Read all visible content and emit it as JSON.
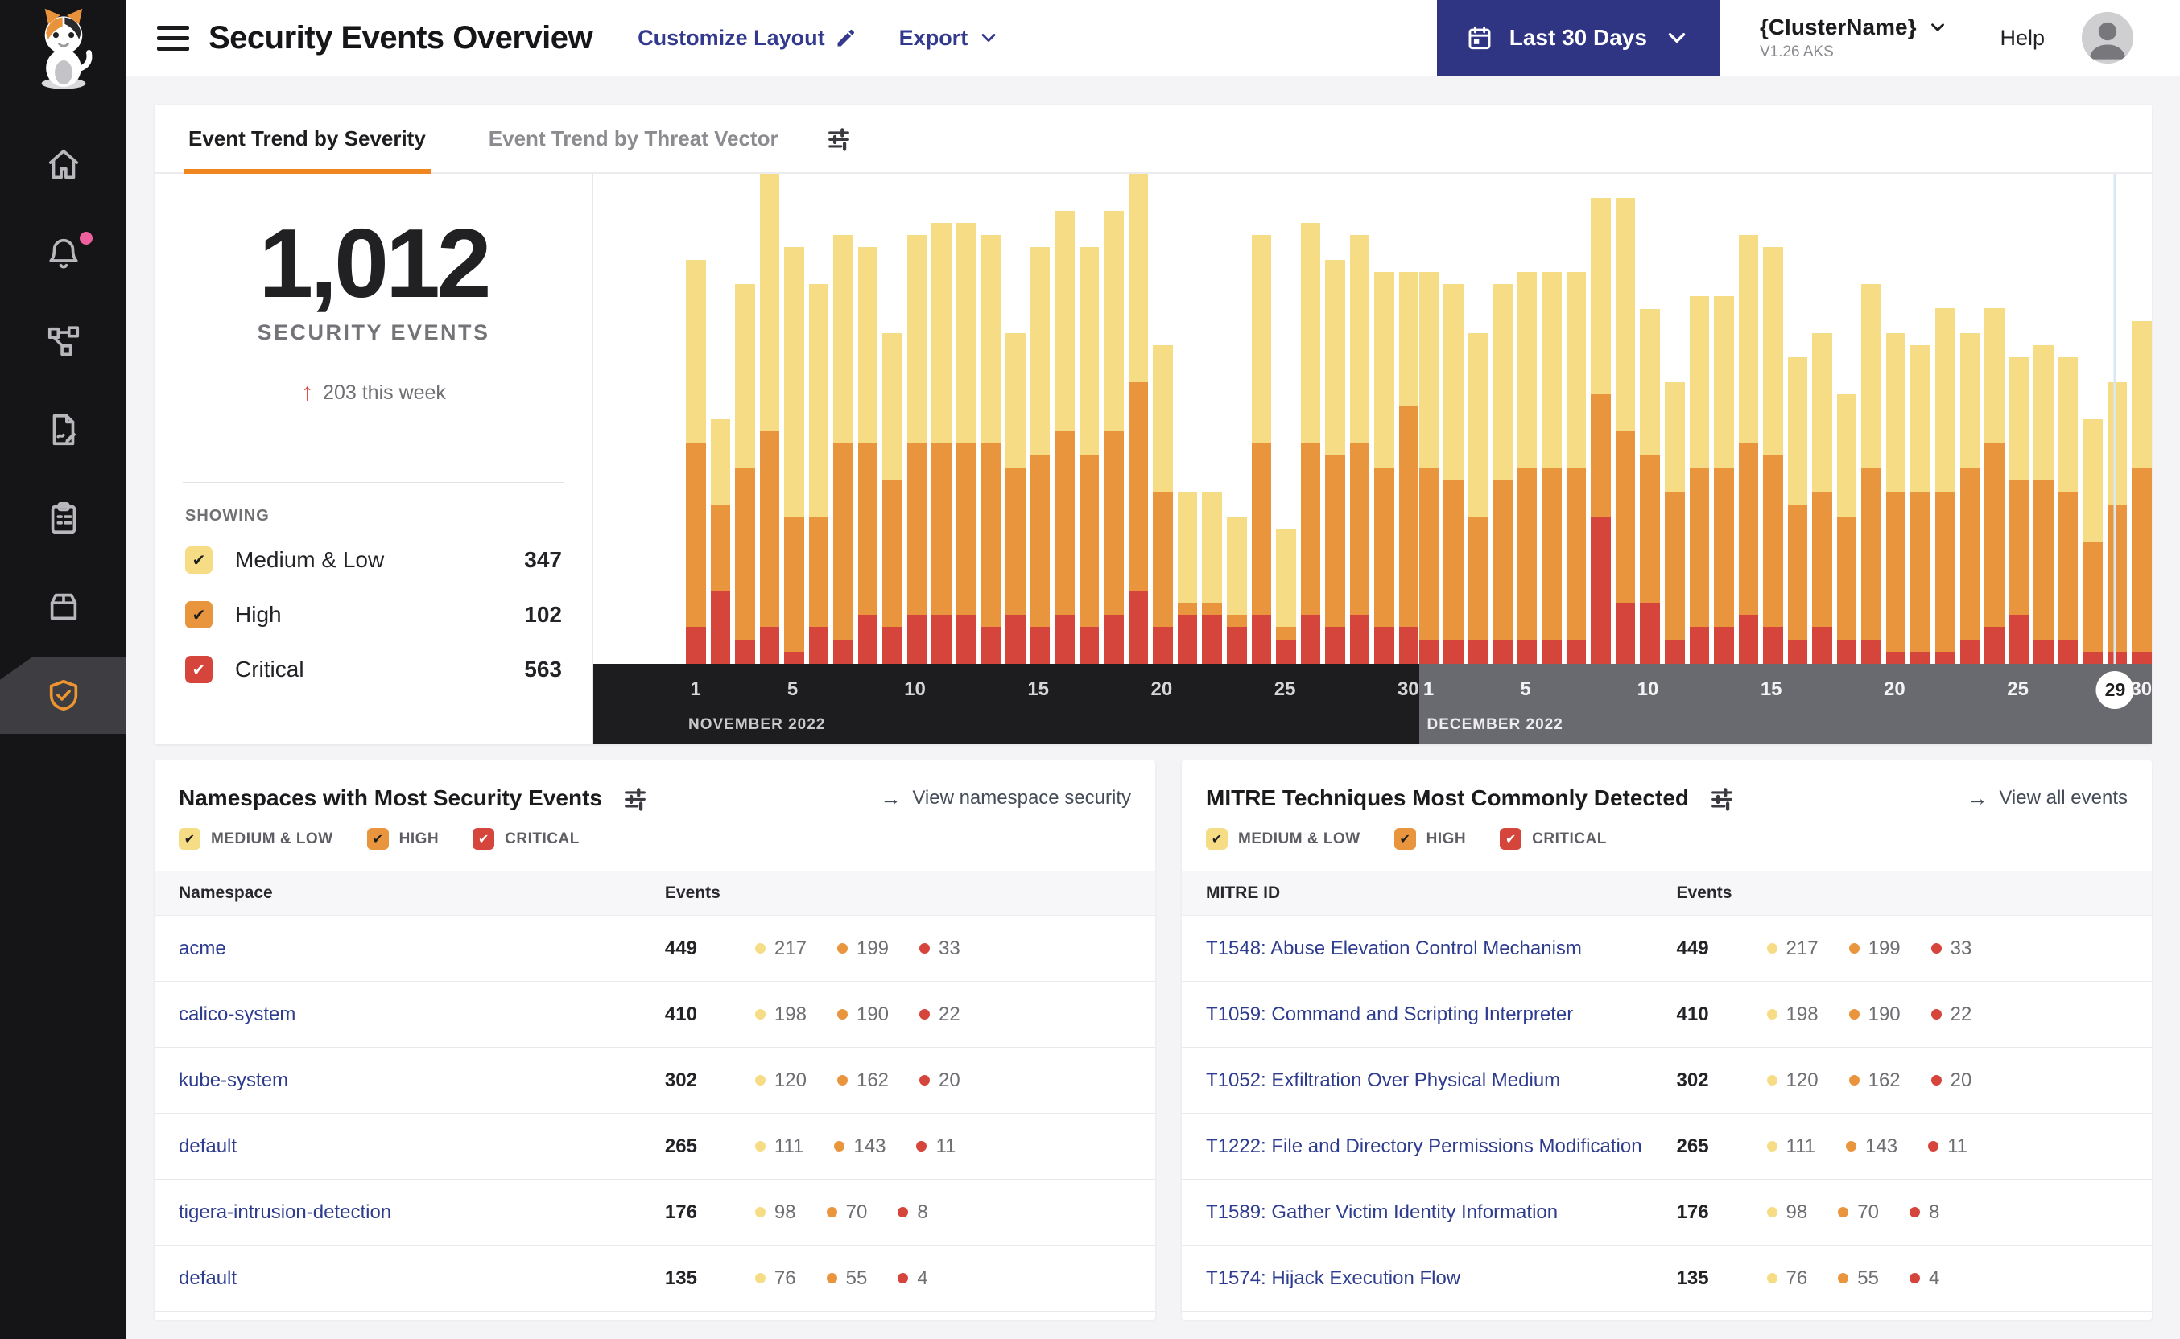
{
  "header": {
    "title": "Security Events Overview",
    "customize_label": "Customize Layout",
    "export_label": "Export",
    "date_range_label": "Last 30 Days",
    "cluster_name": "{ClusterName}",
    "cluster_version": "V1.26 AKS",
    "help_label": "Help"
  },
  "sidebar": {
    "items": [
      {
        "icon": "home-icon",
        "active": false,
        "badge": false
      },
      {
        "icon": "notifications-bell-icon",
        "active": false,
        "badge": true
      },
      {
        "icon": "service-graph-icon",
        "active": false,
        "badge": false
      },
      {
        "icon": "policies-icon",
        "active": false,
        "badge": false
      },
      {
        "icon": "compliance-reports-icon",
        "active": false,
        "badge": false
      },
      {
        "icon": "workloads-icon",
        "active": false,
        "badge": false
      },
      {
        "icon": "threat-defense-shield-icon",
        "active": true,
        "badge": false
      }
    ],
    "badge_color": "#f0609e"
  },
  "tabs": {
    "severity": "Event Trend by Severity",
    "threat_vector": "Event Trend by Threat Vector"
  },
  "summary": {
    "total": "1,012",
    "total_caption": "SECURITY EVENTS",
    "delta_arrow": "↑",
    "delta": "203 this week",
    "showing_label": "SHOWING"
  },
  "severities": [
    {
      "key": "medium_low",
      "label": "Medium & Low",
      "chip_label": "MEDIUM & LOW",
      "count": 347,
      "color": "#F6DC85",
      "check_color": "#1d1d1f"
    },
    {
      "key": "high",
      "label": "High",
      "chip_label": "HIGH",
      "count": 102,
      "color": "#E9953D",
      "check_color": "#1d1d1f"
    },
    {
      "key": "critical",
      "label": "Critical",
      "chip_label": "CRITICAL",
      "count": 563,
      "color": "#D5453C",
      "check_color": "#ffffff"
    }
  ],
  "namespaces": {
    "title": "Namespaces with Most Security Events",
    "link_arrow": "→",
    "link": "View namespace security",
    "col1": "Namespace",
    "col2": "Events",
    "rows": [
      {
        "name": "acme",
        "total": 449,
        "medium_low": 217,
        "high": 199,
        "critical": 33
      },
      {
        "name": "calico-system",
        "total": 410,
        "medium_low": 198,
        "high": 190,
        "critical": 22
      },
      {
        "name": "kube-system",
        "total": 302,
        "medium_low": 120,
        "high": 162,
        "critical": 20
      },
      {
        "name": "default",
        "total": 265,
        "medium_low": 111,
        "high": 143,
        "critical": 11
      },
      {
        "name": "tigera-intrusion-detection",
        "total": 176,
        "medium_low": 98,
        "high": 70,
        "critical": 8
      },
      {
        "name": "default",
        "total": 135,
        "medium_low": 76,
        "high": 55,
        "critical": 4
      }
    ]
  },
  "mitre": {
    "title": "MITRE Techniques Most Commonly Detected",
    "link_arrow": "→",
    "link": "View all events",
    "col1": "MITRE ID",
    "col2": "Events",
    "rows": [
      {
        "name": "T1548: Abuse Elevation Control Mechanism",
        "total": 449,
        "medium_low": 217,
        "high": 199,
        "critical": 33
      },
      {
        "name": "T1059: Command and Scripting Interpreter",
        "total": 410,
        "medium_low": 198,
        "high": 190,
        "critical": 22
      },
      {
        "name": "T1052: Exfiltration Over Physical Medium",
        "total": 302,
        "medium_low": 120,
        "high": 162,
        "critical": 20
      },
      {
        "name": "T1222: File and Directory Permissions Modification",
        "total": 265,
        "medium_low": 111,
        "high": 143,
        "critical": 11
      },
      {
        "name": "T1589: Gather Victim Identity Information",
        "total": 176,
        "medium_low": 98,
        "high": 70,
        "critical": 8
      },
      {
        "name": "T1574: Hijack Execution Flow",
        "total": 135,
        "medium_low": 76,
        "high": 55,
        "critical": 4
      }
    ]
  },
  "chart_data": {
    "type": "bar",
    "stacked": true,
    "title": "Event Trend by Severity",
    "unit": "security events per day",
    "y_max_per_day": 40,
    "grid": false,
    "legend": [
      "Medium & Low",
      "High",
      "Critical"
    ],
    "colors": {
      "medium_low": "#F6DC85",
      "high": "#E9953D",
      "critical": "#D5453C"
    },
    "axis_colors": [
      "#1d1d1f",
      "#696970"
    ],
    "tick_days": [
      1,
      5,
      10,
      15,
      20,
      25,
      30
    ],
    "selected": {
      "month": "DECEMBER 2022",
      "day": 29
    },
    "months": [
      {
        "label": "NOVEMBER 2022",
        "days": [
          {
            "d": 1,
            "ml": 15,
            "h": 15,
            "c": 3
          },
          {
            "d": 2,
            "ml": 7,
            "h": 7,
            "c": 6
          },
          {
            "d": 3,
            "ml": 15,
            "h": 14,
            "c": 2
          },
          {
            "d": 4,
            "ml": 21,
            "h": 16,
            "c": 3
          },
          {
            "d": 5,
            "ml": 22,
            "h": 11,
            "c": 1
          },
          {
            "d": 6,
            "ml": 19,
            "h": 9,
            "c": 3
          },
          {
            "d": 7,
            "ml": 17,
            "h": 16,
            "c": 2
          },
          {
            "d": 8,
            "ml": 16,
            "h": 14,
            "c": 4
          },
          {
            "d": 9,
            "ml": 12,
            "h": 12,
            "c": 3
          },
          {
            "d": 10,
            "ml": 17,
            "h": 14,
            "c": 4
          },
          {
            "d": 11,
            "ml": 18,
            "h": 14,
            "c": 4
          },
          {
            "d": 12,
            "ml": 18,
            "h": 14,
            "c": 4
          },
          {
            "d": 13,
            "ml": 17,
            "h": 15,
            "c": 3
          },
          {
            "d": 14,
            "ml": 11,
            "h": 12,
            "c": 4
          },
          {
            "d": 15,
            "ml": 17,
            "h": 14,
            "c": 3
          },
          {
            "d": 16,
            "ml": 18,
            "h": 15,
            "c": 4
          },
          {
            "d": 17,
            "ml": 17,
            "h": 14,
            "c": 3
          },
          {
            "d": 18,
            "ml": 18,
            "h": 15,
            "c": 4
          },
          {
            "d": 19,
            "ml": 17,
            "h": 17,
            "c": 6
          },
          {
            "d": 20,
            "ml": 12,
            "h": 11,
            "c": 3
          },
          {
            "d": 21,
            "ml": 9,
            "h": 1,
            "c": 4
          },
          {
            "d": 22,
            "ml": 9,
            "h": 1,
            "c": 4
          },
          {
            "d": 23,
            "ml": 8,
            "h": 1,
            "c": 3
          },
          {
            "d": 24,
            "ml": 17,
            "h": 14,
            "c": 4
          },
          {
            "d": 25,
            "ml": 8,
            "h": 1,
            "c": 2
          },
          {
            "d": 26,
            "ml": 18,
            "h": 14,
            "c": 4
          },
          {
            "d": 27,
            "ml": 16,
            "h": 14,
            "c": 3
          },
          {
            "d": 28,
            "ml": 17,
            "h": 14,
            "c": 4
          },
          {
            "d": 29,
            "ml": 16,
            "h": 13,
            "c": 3
          },
          {
            "d": 30,
            "ml": 11,
            "h": 18,
            "c": 3
          }
        ]
      },
      {
        "label": "DECEMBER 2022",
        "days": [
          {
            "d": 1,
            "ml": 16,
            "h": 14,
            "c": 2
          },
          {
            "d": 2,
            "ml": 16,
            "h": 13,
            "c": 2
          },
          {
            "d": 3,
            "ml": 15,
            "h": 10,
            "c": 2
          },
          {
            "d": 4,
            "ml": 16,
            "h": 13,
            "c": 2
          },
          {
            "d": 5,
            "ml": 16,
            "h": 14,
            "c": 2
          },
          {
            "d": 6,
            "ml": 16,
            "h": 14,
            "c": 2
          },
          {
            "d": 7,
            "ml": 16,
            "h": 14,
            "c": 2
          },
          {
            "d": 8,
            "ml": 16,
            "h": 10,
            "c": 12
          },
          {
            "d": 9,
            "ml": 19,
            "h": 14,
            "c": 5
          },
          {
            "d": 10,
            "ml": 12,
            "h": 12,
            "c": 5
          },
          {
            "d": 11,
            "ml": 9,
            "h": 12,
            "c": 2
          },
          {
            "d": 12,
            "ml": 14,
            "h": 13,
            "c": 3
          },
          {
            "d": 13,
            "ml": 14,
            "h": 13,
            "c": 3
          },
          {
            "d": 14,
            "ml": 17,
            "h": 14,
            "c": 4
          },
          {
            "d": 15,
            "ml": 17,
            "h": 14,
            "c": 3
          },
          {
            "d": 16,
            "ml": 12,
            "h": 11,
            "c": 2
          },
          {
            "d": 17,
            "ml": 13,
            "h": 11,
            "c": 3
          },
          {
            "d": 18,
            "ml": 10,
            "h": 10,
            "c": 2
          },
          {
            "d": 19,
            "ml": 15,
            "h": 14,
            "c": 2
          },
          {
            "d": 20,
            "ml": 13,
            "h": 13,
            "c": 1
          },
          {
            "d": 21,
            "ml": 12,
            "h": 13,
            "c": 1
          },
          {
            "d": 22,
            "ml": 15,
            "h": 13,
            "c": 1
          },
          {
            "d": 23,
            "ml": 11,
            "h": 14,
            "c": 2
          },
          {
            "d": 24,
            "ml": 11,
            "h": 15,
            "c": 3
          },
          {
            "d": 25,
            "ml": 10,
            "h": 11,
            "c": 4
          },
          {
            "d": 26,
            "ml": 11,
            "h": 13,
            "c": 2
          },
          {
            "d": 27,
            "ml": 11,
            "h": 12,
            "c": 2
          },
          {
            "d": 28,
            "ml": 10,
            "h": 9,
            "c": 1
          },
          {
            "d": 29,
            "ml": 10,
            "h": 12,
            "c": 1
          },
          {
            "d": 30,
            "ml": 12,
            "h": 15,
            "c": 1
          }
        ]
      }
    ]
  }
}
